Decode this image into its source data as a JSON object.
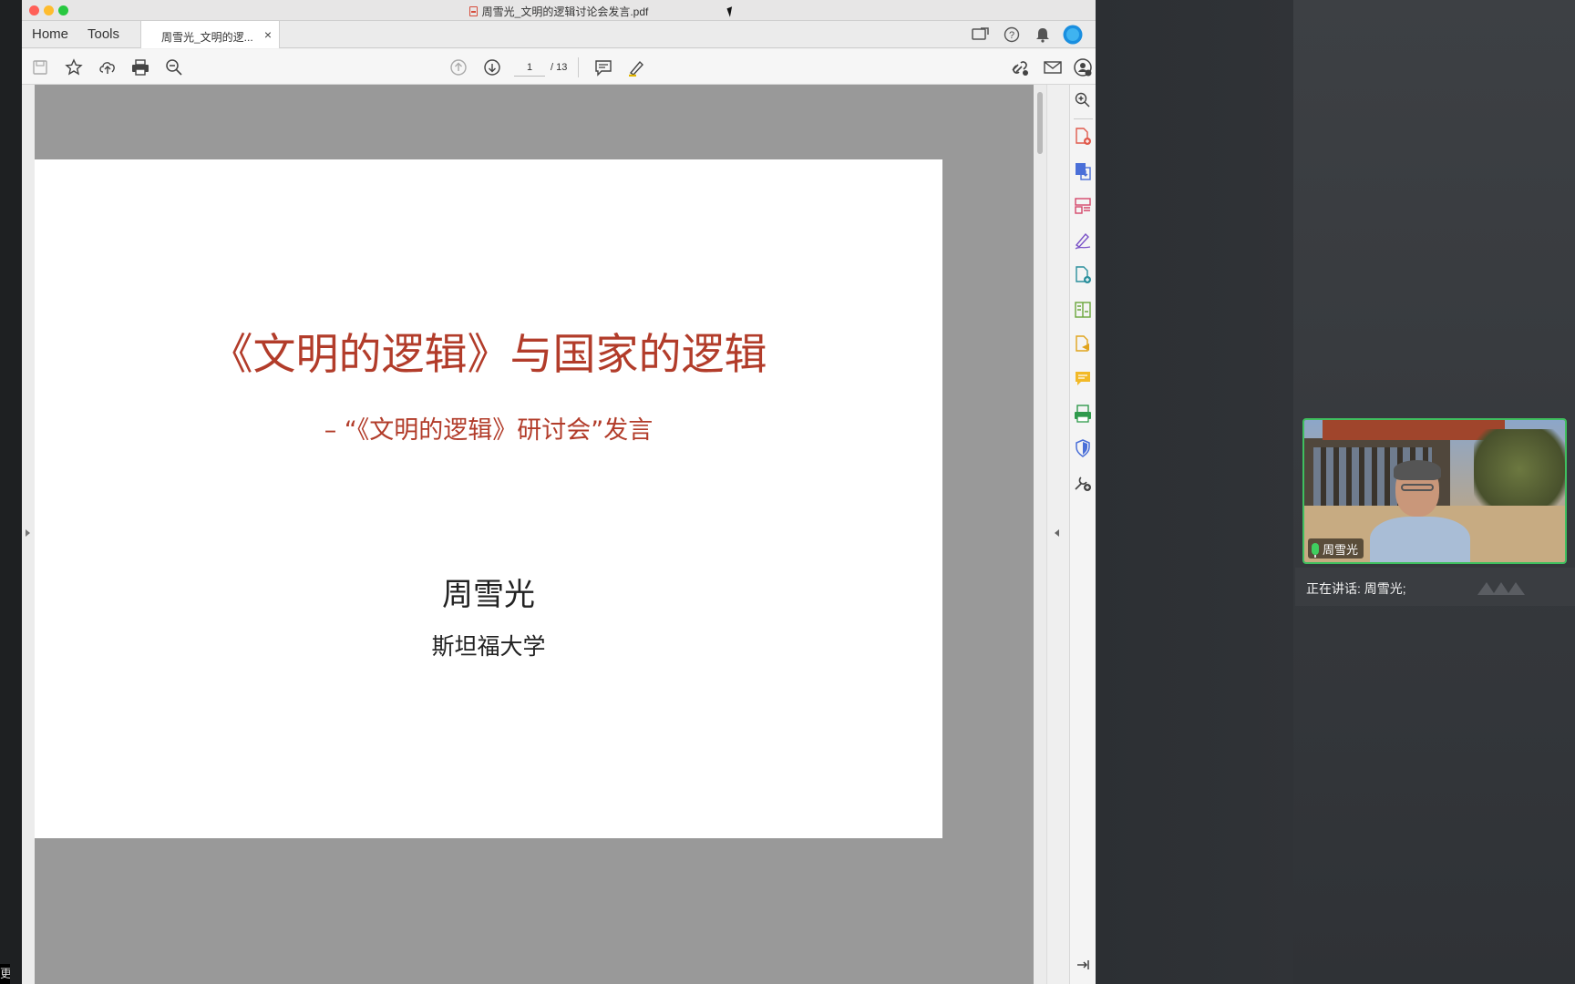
{
  "window": {
    "title": "周雪光_文明的逻辑讨论会发言.pdf"
  },
  "tabs": {
    "home": "Home",
    "tools": "Tools",
    "document": "周雪光_文明的逻...",
    "close": "×"
  },
  "toolbar": {
    "current_page": "1",
    "total_pages": "/ 13"
  },
  "document": {
    "title": "《文明的逻辑》与国家的逻辑",
    "subtitle": "– “《文明的逻辑》研讨会”发言",
    "author": "周雪光",
    "affiliation": "斯坦福大学"
  },
  "meeting": {
    "participant_name": "周雪光",
    "speaking_text": "正在讲话: 周雪光;"
  },
  "left_corner_text": "更",
  "colors": {
    "title_red": "#b23c2a",
    "active_speaker_border": "#3fbf5f",
    "avatar_blue": "#1a8fe0"
  },
  "icons": {
    "toolbar": [
      "save-icon",
      "bookmark-star-icon",
      "upload-cloud-icon",
      "print-icon",
      "zoom-out-icon",
      "page-up-icon",
      "page-down-icon",
      "comment-icon",
      "highlight-pen-icon",
      "link-icon",
      "mail-icon",
      "share-user-icon"
    ],
    "rail": [
      "zoom-in-icon",
      "create-pdf-icon",
      "export-pdf-icon",
      "organize-pages-icon",
      "fill-sign-icon",
      "edit-pdf-icon",
      "compress-icon",
      "request-signature-icon",
      "comment-icon",
      "scan-ocr-icon",
      "protect-icon",
      "more-tools-icon"
    ]
  }
}
